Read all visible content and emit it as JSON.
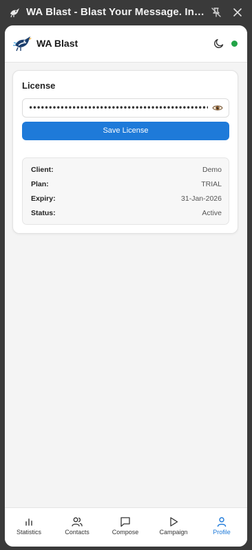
{
  "window": {
    "title": "WA Blast - Blast Your Message. Instantly."
  },
  "header": {
    "brand": "WA Blast",
    "status_color": "#22a447"
  },
  "license_card": {
    "title": "License",
    "license_value": "••••••••••••••••••••••••••••••••••••••••••••••••••••",
    "save_label": "Save License",
    "info": [
      {
        "key": "Client:",
        "value": "Demo"
      },
      {
        "key": "Plan:",
        "value": "TRIAL"
      },
      {
        "key": "Expiry:",
        "value": "31-Jan-2026"
      },
      {
        "key": "Status:",
        "value": "Active"
      }
    ]
  },
  "nav": {
    "items": [
      {
        "label": "Statistics",
        "icon": "bar-chart-icon"
      },
      {
        "label": "Contacts",
        "icon": "users-icon"
      },
      {
        "label": "Compose",
        "icon": "message-square-icon"
      },
      {
        "label": "Campaign",
        "icon": "play-icon"
      },
      {
        "label": "Profile",
        "icon": "user-icon"
      }
    ],
    "active": "Profile"
  },
  "colors": {
    "accent": "#1e7ad9",
    "titlebar": "#3a3a3a",
    "background": "#f4f4f4"
  }
}
